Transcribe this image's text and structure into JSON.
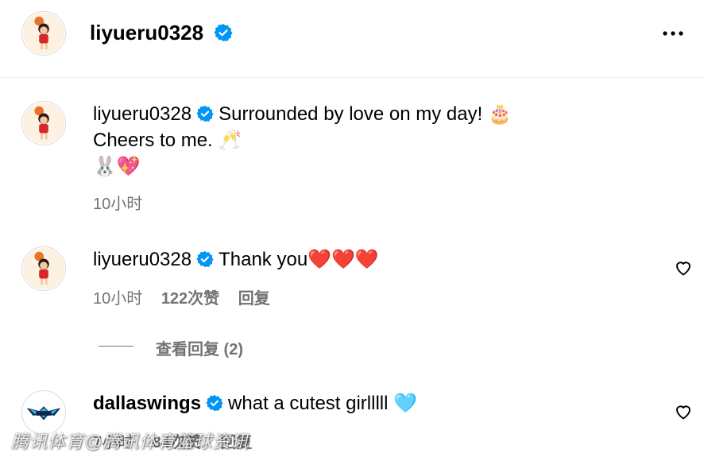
{
  "header": {
    "username": "liyueru0328",
    "more_icon": "more-horizontal-icon"
  },
  "caption": {
    "username": "liyueru0328",
    "text_line1": "Surrounded by love on my day! 🎂",
    "text_line2": "Cheers to me. 🥂",
    "text_line3": "🐰💖",
    "time": "10小时"
  },
  "comments": [
    {
      "username": "liyueru0328",
      "text": "Thank you❤️❤️❤️",
      "time": "10小时",
      "likes": "122次赞",
      "reply": "回复",
      "view_replies": "查看回复 (2)"
    },
    {
      "username": "dallaswings",
      "text": "what a cutest girlllll 🩵",
      "time": "7小时",
      "likes": "84次赞",
      "reply": "回复"
    }
  ],
  "watermark": "腾讯体育@腾讯体育篮球资讯",
  "colors": {
    "verified": "#0095f6",
    "muted": "#737373",
    "divider": "#efefef"
  }
}
